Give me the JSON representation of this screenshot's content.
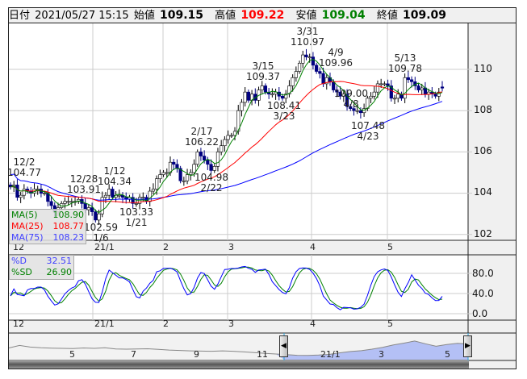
{
  "header": {
    "date_label": "日付",
    "date": "2021/05/27 15:15",
    "open_label": "始値",
    "open": "109.15",
    "high_label": "高値",
    "high": "109.22",
    "low_label": "安値",
    "low": "109.04",
    "close_label": "終値",
    "close": "109.09"
  },
  "colors": {
    "high": "#ff0000",
    "low": "#008000",
    "up_candle": "#ffffff",
    "down_candle": "#000080",
    "ma5": "#008000",
    "ma25": "#ff0000",
    "ma75": "#0000ff",
    "k": "#0000ff",
    "sd": "#008000",
    "navigator_fill": "#b4c0f5"
  },
  "main_axis": {
    "labels": [
      "110",
      "108",
      "106",
      "104",
      "102"
    ]
  },
  "x_axis": {
    "labels": [
      "12",
      "21/1",
      "2",
      "3",
      "4",
      "5"
    ]
  },
  "legend": {
    "ma5_label": "MA(5)",
    "ma5": "108.90",
    "ma25_label": "MA(25)",
    "ma25": "108.77",
    "ma75_label": "MA(75)",
    "ma75": "108.23"
  },
  "annotations": [
    {
      "date": "12/2",
      "value": "104.77"
    },
    {
      "date": "12/28",
      "value": "103.91"
    },
    {
      "date": "1/12",
      "value": "104.34"
    },
    {
      "date": "1/6",
      "value": "102.59"
    },
    {
      "date": "1/21",
      "value": "103.33"
    },
    {
      "date": "2/17",
      "value": "106.22"
    },
    {
      "date": "2/22",
      "value": "104.98"
    },
    {
      "date": "3/15",
      "value": "109.37"
    },
    {
      "date": "3/23",
      "value": "108.41"
    },
    {
      "date": "3/31",
      "value": "110.97"
    },
    {
      "date": "4/9",
      "value": "109.96"
    },
    {
      "date": "4/8",
      "value": "109.00"
    },
    {
      "date": "4/23",
      "value": "107.48"
    },
    {
      "date": "5/13",
      "value": "109.78"
    }
  ],
  "stoch": {
    "d_label": "%D",
    "d": "32.51",
    "sd_label": "%SD",
    "sd": "26.90",
    "axis_labels": [
      "80.0",
      "40.0",
      "0.0"
    ]
  },
  "navigator": {
    "labels": [
      "5",
      "7",
      "9",
      "11",
      "21/1",
      "3",
      "5"
    ],
    "series": [
      107.2,
      108.4,
      107.6,
      107.3,
      107.1,
      107.0,
      106.9,
      107.2,
      107.0,
      107.3,
      106.7,
      106.6,
      106.7,
      106.8,
      106.5,
      106.2,
      106.0,
      105.8,
      105.7,
      105.6,
      105.8,
      105.6,
      105.3,
      105.0,
      104.6,
      104.3,
      104.0,
      103.7,
      103.6,
      103.8,
      104.1,
      104.9,
      105.5,
      105.9,
      106.6,
      107.5,
      108.6,
      109.5,
      110.5,
      109.2,
      108.0,
      108.8,
      109.4,
      109.1
    ]
  },
  "chart_data": {
    "type": "candlestick",
    "title": "",
    "ylim": [
      101.8,
      111.5
    ],
    "date_range": [
      "2020/12/01",
      "2021/05/27"
    ],
    "closes": [
      104.3,
      104.4,
      103.8,
      103.9,
      104.2,
      104.1,
      104.0,
      104.2,
      104.2,
      104.0,
      104.0,
      103.6,
      103.4,
      103.1,
      103.3,
      103.5,
      103.6,
      103.6,
      103.6,
      103.6,
      103.7,
      103.5,
      103.2,
      103.3,
      103.1,
      102.7,
      103.0,
      103.8,
      103.9,
      104.2,
      103.8,
      103.9,
      103.9,
      103.8,
      103.7,
      103.8,
      103.5,
      103.5,
      103.8,
      103.8,
      103.6,
      104.1,
      104.2,
      104.7,
      104.9,
      105.0,
      105.0,
      105.5,
      105.4,
      105.2,
      104.6,
      104.6,
      104.9,
      105.0,
      105.4,
      106.0,
      105.8,
      105.6,
      105.4,
      105.1,
      105.3,
      106.0,
      106.3,
      106.6,
      106.8,
      106.8,
      107.0,
      108.0,
      108.4,
      108.9,
      108.5,
      108.8,
      108.5,
      109.0,
      109.2,
      108.9,
      108.8,
      108.8,
      108.9,
      108.7,
      108.6,
      108.8,
      109.2,
      109.6,
      109.9,
      110.3,
      110.7,
      110.6,
      110.6,
      110.2,
      109.9,
      109.8,
      109.3,
      109.6,
      109.4,
      109.0,
      108.9,
      108.7,
      108.8,
      108.2,
      108.1,
      108.0,
      108.0,
      107.9,
      108.1,
      108.6,
      108.7,
      108.9,
      109.3,
      109.3,
      109.3,
      109.2,
      108.6,
      108.6,
      108.8,
      108.6,
      109.6,
      109.5,
      109.4,
      109.2,
      109.0,
      109.1,
      108.8,
      108.9,
      108.8,
      108.7,
      108.9,
      109.09
    ],
    "last_open": 109.15,
    "indicators": [
      "MA(5)",
      "MA(25)",
      "MA(75)",
      "Stochastic %D",
      "Stochastic %SD"
    ]
  }
}
